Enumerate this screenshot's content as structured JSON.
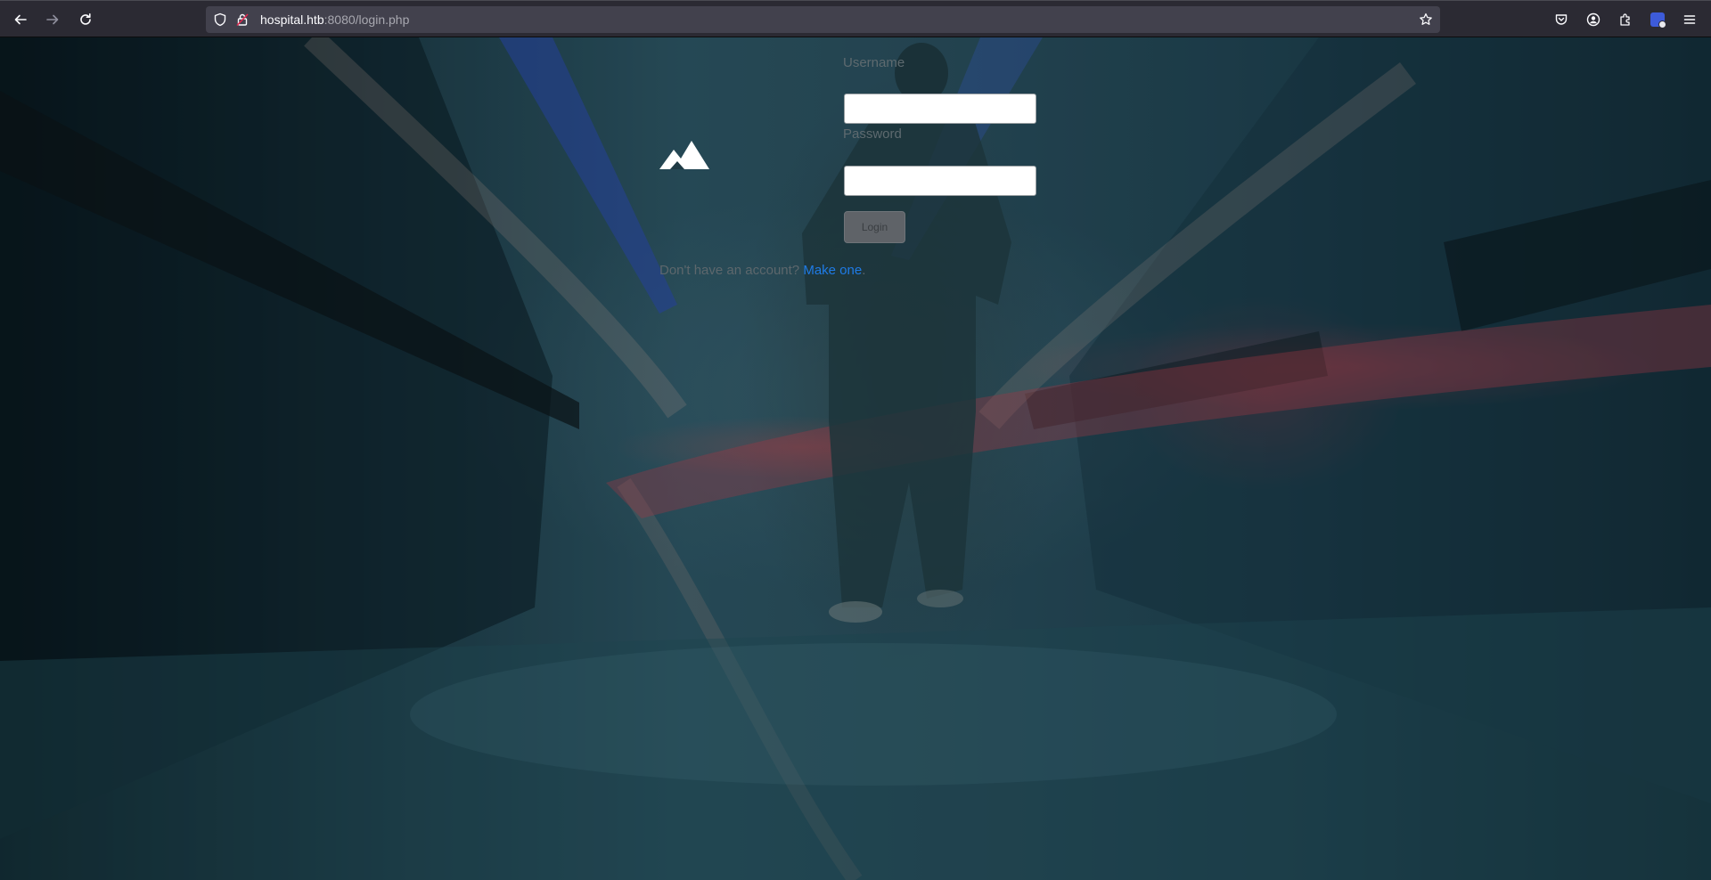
{
  "browser": {
    "url_host": "hospital.htb",
    "url_path": ":8080/login.php",
    "icons": {
      "back": "arrow-left-icon",
      "forward": "arrow-right-icon",
      "reload": "reload-icon",
      "tracking": "shield-icon",
      "lock": "lock-icon",
      "bookmark": "star-icon",
      "pocket": "pocket-icon",
      "account": "account-icon",
      "extensions": "puzzle-icon",
      "extension_badge": "extension-icon",
      "menu": "hamburger-menu-icon"
    }
  },
  "login": {
    "logo": "mountain-logo",
    "username_label": "Username",
    "username_value": "",
    "password_label": "Password",
    "password_value": "",
    "login_button": "Login",
    "signup_prompt": "Don't have an account?",
    "signup_link": "Make one",
    "signup_suffix": "."
  },
  "colors": {
    "link": "#1f7be6",
    "toolbar": "#2b2a33",
    "urlbar": "#42414d"
  }
}
